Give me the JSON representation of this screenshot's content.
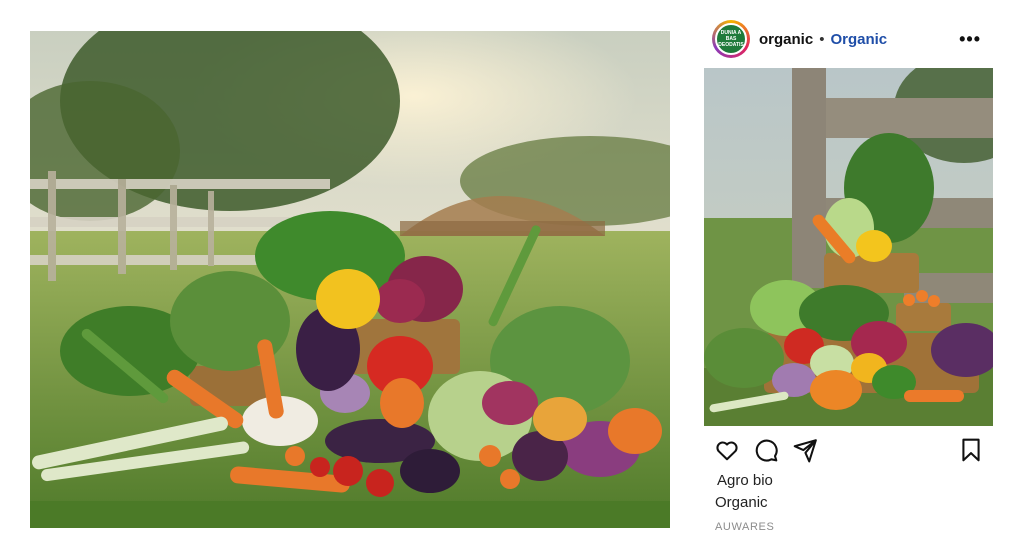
{
  "post": {
    "account": {
      "username": "organic",
      "separator": "•",
      "link_label": "Organic",
      "avatar_text": "DUNIA A BAS DEODATIS"
    },
    "more_icon": "more-horizontal-icon",
    "actions": [
      "heart-icon",
      "comment-icon",
      "send-icon",
      "bookmark-icon"
    ],
    "caption": {
      "line1": "Agro bio",
      "line2": "Organic",
      "line3": "AUWARES"
    }
  },
  "colors": {
    "link": "#1f4ea8",
    "muted": "#8c8c8c",
    "avatar_bg": "#1f7a3a"
  }
}
